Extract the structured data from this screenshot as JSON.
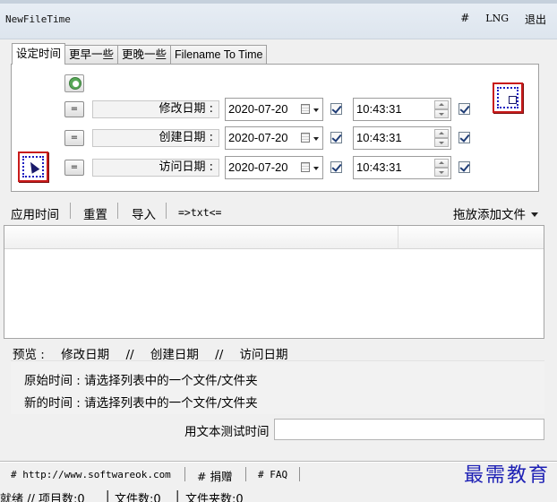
{
  "window": {
    "title": "NewFileTime"
  },
  "menu": {
    "hash": "#",
    "lng": "LNG",
    "exit": "退出"
  },
  "tabs": [
    {
      "label": "设定时间",
      "active": true
    },
    {
      "label": "更早一些",
      "active": false
    },
    {
      "label": "更晚一些",
      "active": false
    },
    {
      "label": "Filename To Time",
      "active": false
    }
  ],
  "rows": [
    {
      "eq": "=",
      "label": "修改日期 :",
      "date": "2020-07-20",
      "time": "10:43:31"
    },
    {
      "eq": "=",
      "label": "创建日期 :",
      "date": "2020-07-20",
      "time": "10:43:31"
    },
    {
      "eq": "=",
      "label": "访问日期 :",
      "date": "2020-07-20",
      "time": "10:43:31"
    }
  ],
  "toolbar": {
    "apply": "应用时间",
    "reset": "重置",
    "import": "导入",
    "txt": "=>txt<=",
    "drag_add": "拖放添加文件"
  },
  "preview": {
    "label": "预览 :",
    "modified": "修改日期",
    "sep": "//",
    "created": "创建日期",
    "accessed": "访问日期"
  },
  "info": {
    "original": "原始时间 : 请选择列表中的一个文件/文件夹",
    "new": "新的时间 : 请选择列表中的一个文件/文件夹"
  },
  "test": {
    "label": "用文本测试时间",
    "value": ""
  },
  "bottom": {
    "site": "# http://www.softwareok.com",
    "donate": "# 捐赠",
    "faq": "# FAQ"
  },
  "watermark": "最需教育",
  "status": {
    "ready": "就绪 // 项目数:0",
    "files": "文件数:0",
    "folders": "文件夹数:0"
  }
}
